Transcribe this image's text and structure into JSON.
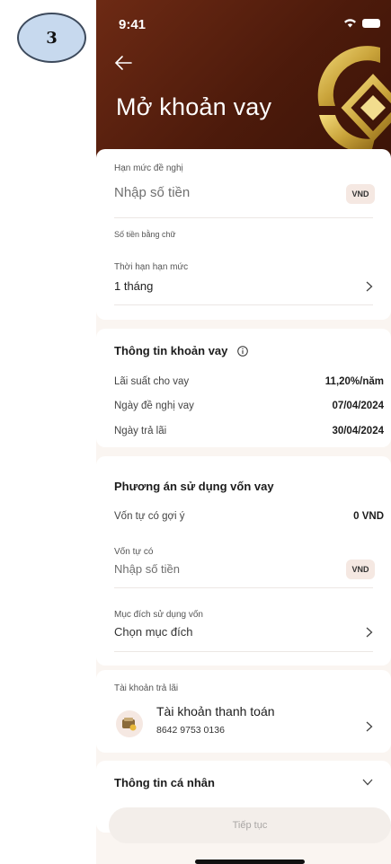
{
  "step_badge": {
    "number": "3"
  },
  "status_bar": {
    "time": "9:41"
  },
  "header": {
    "title": "Mở khoản vay",
    "back_icon": "arrow-left-icon",
    "logo_icon": "bank-logo-icon"
  },
  "limit_card": {
    "proposed_limit_label": "Hạn mức đề nghị",
    "amount_placeholder": "Nhập số tiền",
    "currency": "VND",
    "amount_in_words_label": "Số tiền bằng chữ",
    "term_label": "Thời hạn hạn mức",
    "term_value": "1 tháng"
  },
  "loan_info": {
    "title": "Thông tin khoản vay",
    "rows": [
      {
        "label": "Lãi suất cho vay",
        "value": "11,20%/năm"
      },
      {
        "label": "Ngày đề nghị vay",
        "value": "07/04/2024"
      },
      {
        "label": "Ngày trả lãi",
        "value": "30/04/2024"
      }
    ]
  },
  "capital_plan": {
    "title": "Phương án sử dụng vốn vay",
    "suggested_label": "Vốn tự có gợi ý",
    "suggested_value": "0 VND",
    "own_capital_label": "Vốn tự có",
    "own_capital_placeholder": "Nhập số tiền",
    "currency": "VND",
    "purpose_label": "Mục đích sử dụng vốn",
    "purpose_placeholder": "Chọn mục đích"
  },
  "repayment_account": {
    "label": "Tài khoản trả lãi",
    "account_name": "Tài khoản thanh toán",
    "account_number": "8642 9753 0136"
  },
  "personal_info": {
    "title": "Thông tin cá nhân"
  },
  "footer": {
    "continue_label": "Tiếp tục"
  },
  "colors": {
    "header_brown": "#5a200e",
    "accent_gold": "#c9a33a",
    "pill_bg": "#f5e8e2"
  }
}
